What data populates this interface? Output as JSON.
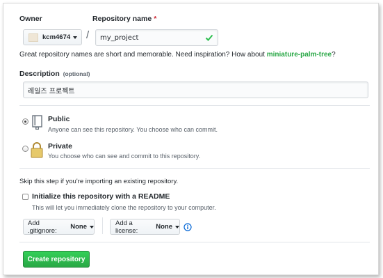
{
  "owner": {
    "label": "Owner",
    "username": "kcm4674"
  },
  "separator": "/",
  "repo_name": {
    "label": "Repository name",
    "required_mark": "*",
    "value": "my_project"
  },
  "suggestion": {
    "text": "Great repository names are short and memorable. Need inspiration? How about ",
    "name": "miniature-palm-tree",
    "end": "?"
  },
  "description": {
    "label": "Description",
    "optional": "(optional)",
    "value": "레일즈 프로젝트"
  },
  "visibility": {
    "public": {
      "title": "Public",
      "desc": "Anyone can see this repository. You choose who can commit.",
      "selected": true
    },
    "private": {
      "title": "Private",
      "desc": "You choose who can see and commit to this repository.",
      "selected": false
    }
  },
  "init": {
    "skip_text": "Skip this step if you're importing an existing repository.",
    "readme_label": "Initialize this repository with a README",
    "readme_desc": "This will let you immediately clone the repository to your computer.",
    "readme_checked": false
  },
  "gitignore": {
    "label": "Add .gitignore:",
    "value": "None"
  },
  "license": {
    "label": "Add a license:",
    "value": "None"
  },
  "submit": {
    "label": "Create repository"
  },
  "colors": {
    "accent_green": "#28a745",
    "valid_check": "#2cbe4e",
    "info_blue": "#0366d6",
    "required_red": "#cb2431"
  }
}
